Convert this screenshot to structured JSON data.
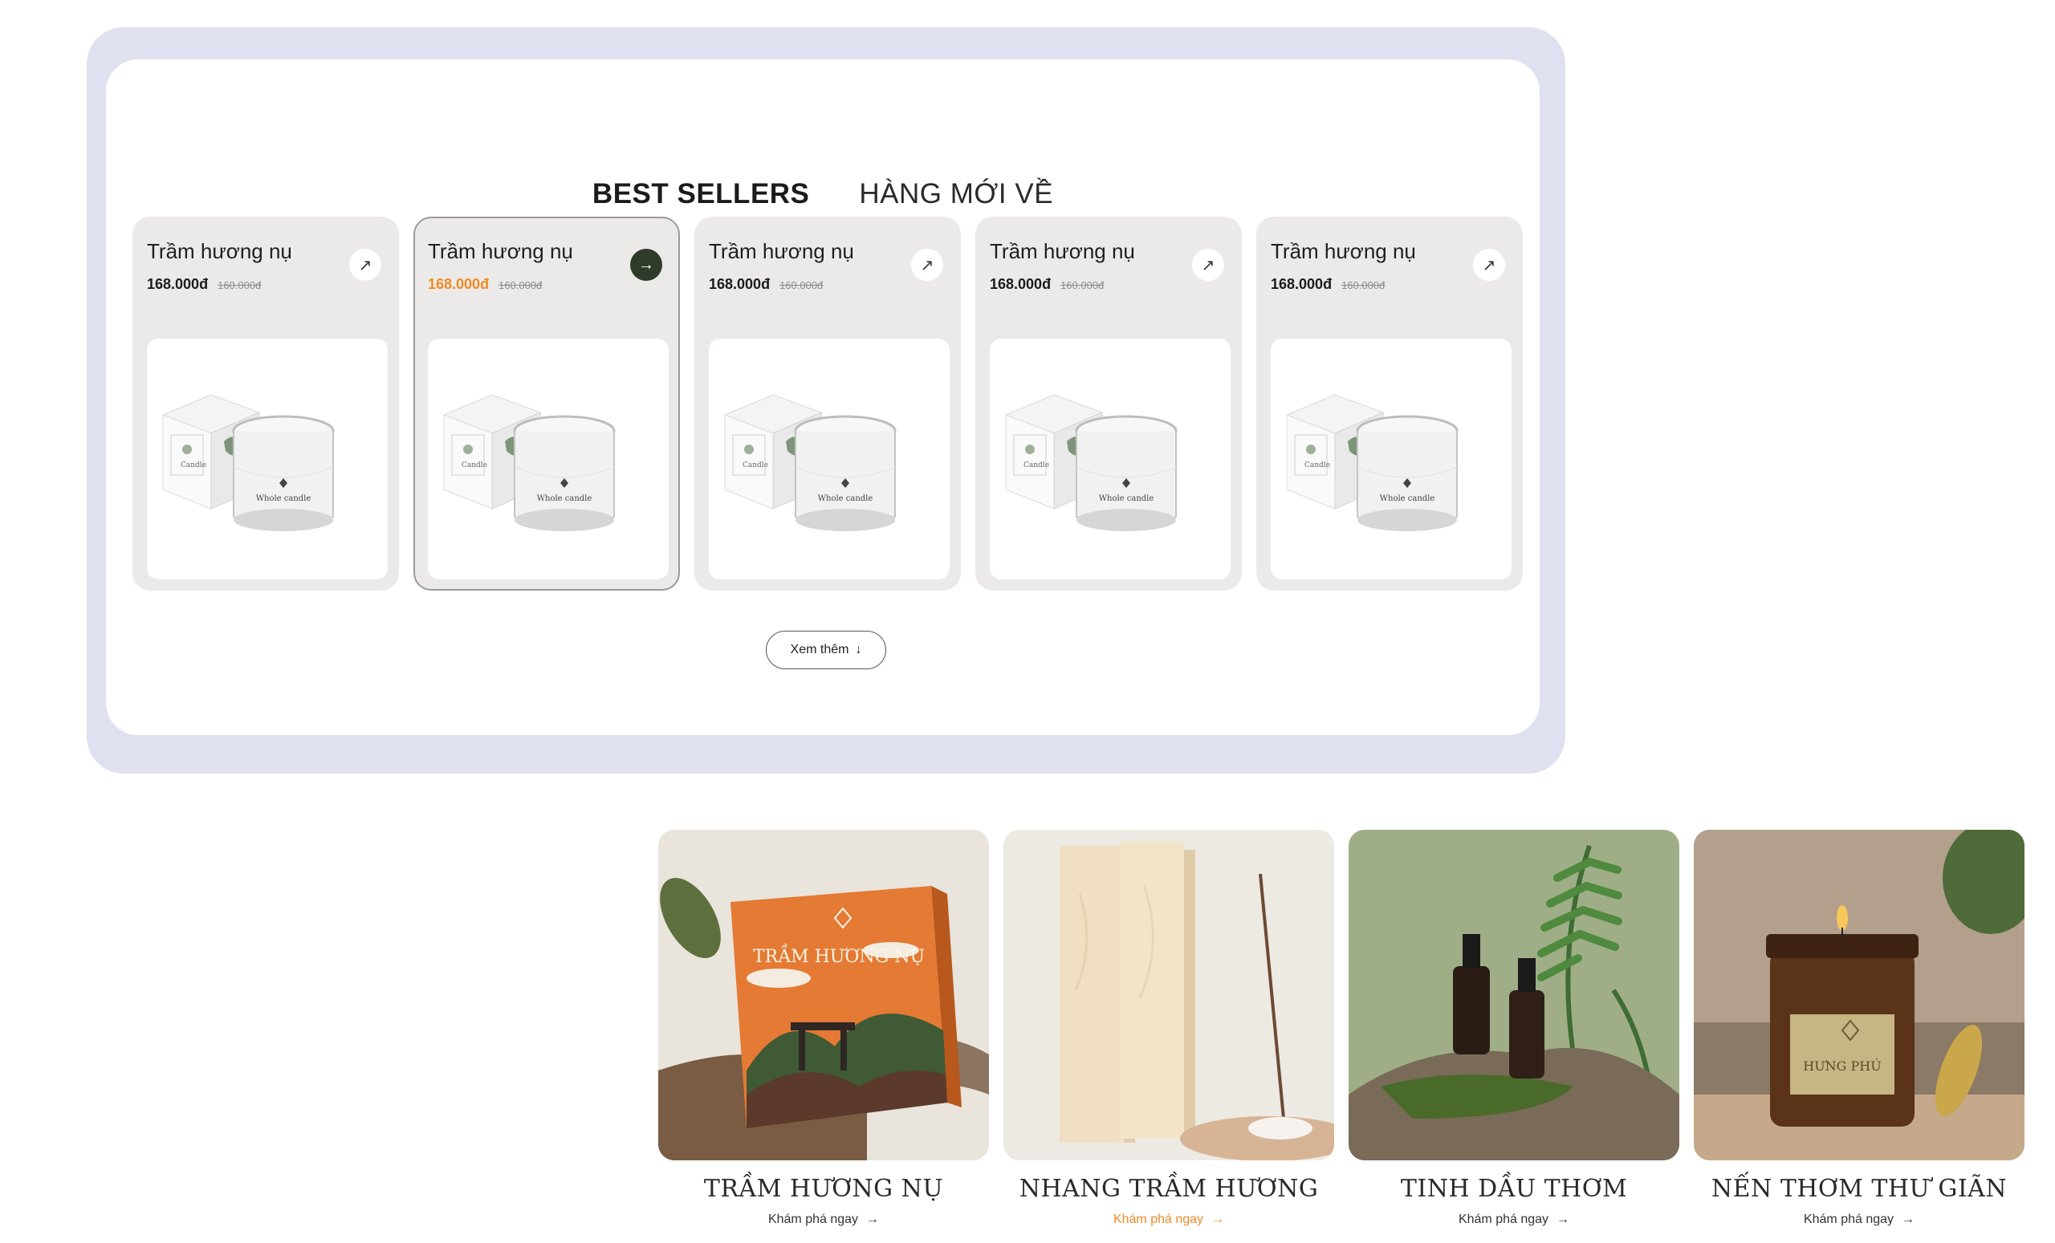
{
  "tabs": {
    "best_sellers": "BEST SELLERS",
    "new_arrivals": "HÀNG MỚI VỀ"
  },
  "products": [
    {
      "name": "Trầm hương nụ",
      "price": "168.000đ",
      "old_price": "160.000đ",
      "button_icon": "arrow-up-right-icon"
    },
    {
      "name": "Trầm hương nụ",
      "price": "168.000đ",
      "old_price": "160.000đ",
      "button_icon": "arrow-right-icon"
    },
    {
      "name": "Trầm hương nụ",
      "price": "168.000đ",
      "old_price": "160.000đ",
      "button_icon": "arrow-up-right-icon"
    },
    {
      "name": "Trầm hương nụ",
      "price": "168.000đ",
      "old_price": "160.000đ",
      "button_icon": "arrow-up-right-icon"
    },
    {
      "name": "Trầm hương nụ",
      "price": "168.000đ",
      "old_price": "160.000đ",
      "button_icon": "arrow-up-right-icon"
    }
  ],
  "product_image_text": {
    "jar_label": "Whole candle",
    "box_label": "Candle"
  },
  "more_button": {
    "label": "Xem thêm",
    "icon": "arrow-down-icon"
  },
  "categories": [
    {
      "title": "TRẦM HƯƠNG NỤ",
      "link": "Khám phá ngay",
      "box_text": "TRẦM HƯƠNG NỤ"
    },
    {
      "title": "NHANG TRẦM HƯƠNG",
      "link": "Khám phá ngay"
    },
    {
      "title": "TINH DẦU THƠM",
      "link": "Khám phá ngay"
    },
    {
      "title": "NẾN THƠM THƯ GIÃN",
      "link": "Khám phá ngay",
      "jar_text": "HƯNG PHÚ"
    }
  ],
  "colors": {
    "panel_bg": "#dfe1f0",
    "card_bg": "#ebeae8",
    "accent_orange": "#ef8a23",
    "dark_green": "#2e3b29"
  }
}
